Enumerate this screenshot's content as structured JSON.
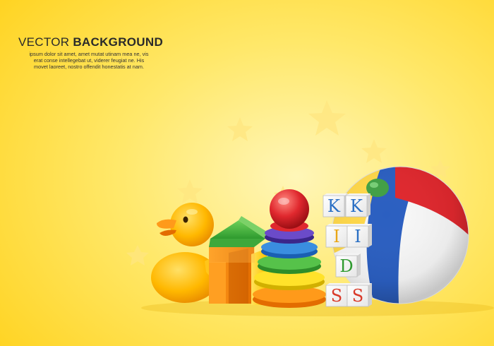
{
  "headline": {
    "light": "VECTOR ",
    "bold": "BACKGROUND"
  },
  "body_lines": [
    "ipsum dolor sit amet, amet mutat utinam mea ne, vis",
    "erat conse intellegebat ut, viderer feugiat ne. His",
    "movet laoreet, nostro offendit honestatis at nam."
  ],
  "blocks": [
    {
      "letter": "K",
      "color": "#2a6fc4"
    },
    {
      "letter": "K",
      "color": "#2a6fc4"
    },
    {
      "letter": "I",
      "color": "#e8a617"
    },
    {
      "letter": "I",
      "color": "#2a6fc4"
    },
    {
      "letter": "D",
      "color": "#2f9a2f"
    },
    {
      "letter": "S",
      "color": "#d93b2b"
    },
    {
      "letter": "S",
      "color": "#d93b2b"
    }
  ],
  "colors": {
    "background": "#ffd21c",
    "duck": "#ffb800",
    "ball_red": "#e0282e",
    "ball_blue": "#2b5fc1",
    "ball_yellow": "#ffd84a",
    "ball_green": "#43a047"
  }
}
